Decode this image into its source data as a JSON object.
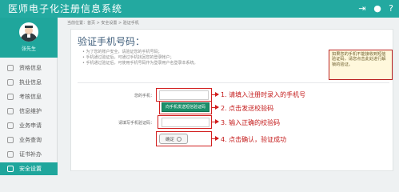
{
  "app": {
    "title": "医师电子化注册信息系统",
    "top_icons": [
      "logout-icon",
      "user-icon",
      "help-icon"
    ],
    "accent_color": "#23a9a0"
  },
  "sidebar": {
    "profile_name": "张先生",
    "items": [
      {
        "label": "资格信息",
        "icon": "certificate-icon"
      },
      {
        "label": "执业信息",
        "icon": "briefcase-icon"
      },
      {
        "label": "考核信息",
        "icon": "clipboard-icon"
      },
      {
        "label": "信息维护",
        "icon": "edit-icon"
      },
      {
        "label": "业务申请",
        "icon": "form-icon"
      },
      {
        "label": "业务查询",
        "icon": "search-icon"
      },
      {
        "label": "证书补办",
        "icon": "document-icon"
      },
      {
        "label": "安全设置",
        "icon": "shield-icon",
        "active": true
      }
    ]
  },
  "breadcrumb": "当前位置：首页 > 安全设置 > 验证手机",
  "form": {
    "title": "验证手机号码：",
    "notes": [
      "为了您的账户安全，请验证您的手机号码；",
      "手机通过验证后，可通过手机找回您的登录帐户；",
      "手机通过验证后，可使用手机号码作为登录用户名登录本系统。"
    ],
    "hint": "如果您的手机不能接收到短信验证码，请您点击此处进行解锁的验证。",
    "phone_label": "您的手机：",
    "phone_value": "",
    "send_button": "向手机发送短信验证码",
    "code_label": "请填写手机验证码：",
    "code_value": "",
    "confirm_button": "确定"
  },
  "annotations": {
    "step1": "1. 请填入注册时录入的手机号",
    "step2": "2. 点击发送校验码",
    "step3": "3. 输入正确的校验码",
    "step4": "4. 点击确认，验证成功",
    "highlight_color": "#d21f1f"
  }
}
